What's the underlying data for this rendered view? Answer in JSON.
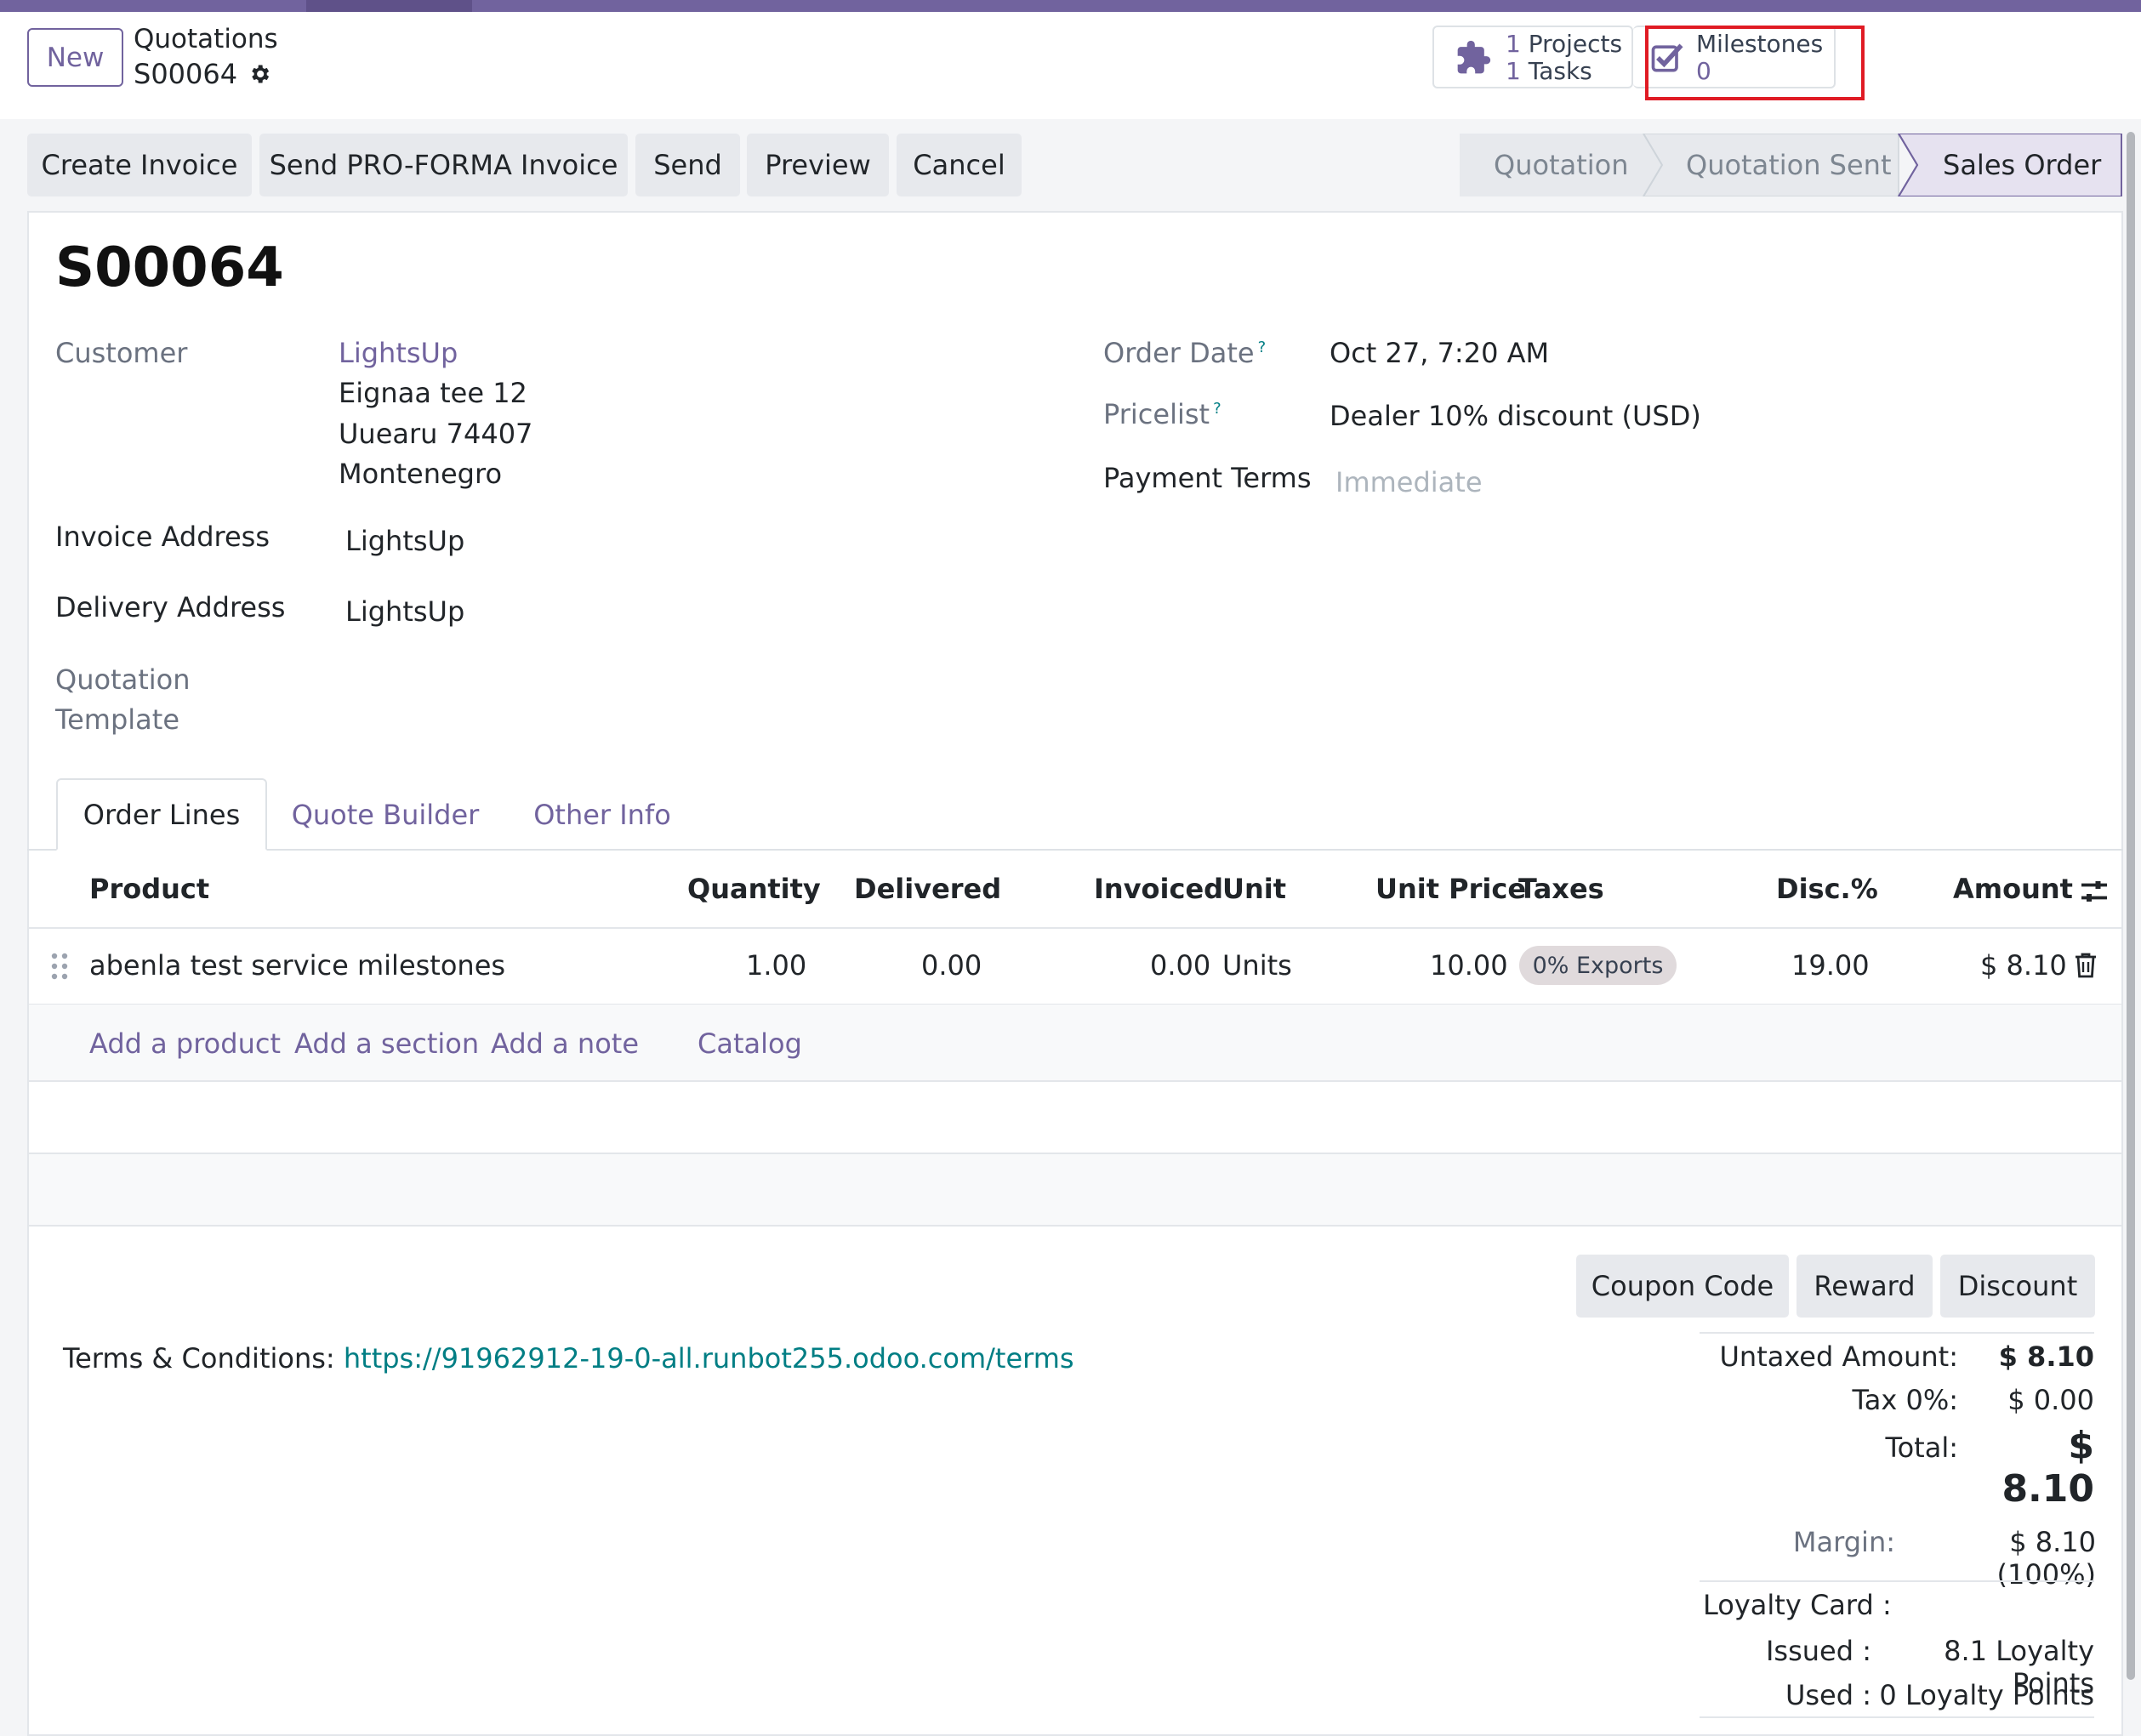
{
  "header": {
    "new_label": "New",
    "breadcrumb_parent": "Quotations",
    "breadcrumb_current": "S00064",
    "smart_buttons": {
      "projects_count": "1",
      "projects_label": "Projects",
      "tasks_count": "1",
      "tasks_label": "Tasks",
      "milestones_label": "Milestones",
      "milestones_count": "0"
    }
  },
  "actions": [
    "Create Invoice",
    "Send PRO-FORMA Invoice",
    "Send",
    "Preview",
    "Cancel"
  ],
  "statusbar": [
    "Quotation",
    "Quotation Sent",
    "Sales Order"
  ],
  "form": {
    "title": "S00064",
    "customer_label": "Customer",
    "customer_name": "LightsUp",
    "customer_address": [
      "Eignaa tee 12",
      "Uuearu 74407",
      "Montenegro"
    ],
    "invoice_address_label": "Invoice Address",
    "invoice_address": "LightsUp",
    "delivery_address_label": "Delivery Address",
    "delivery_address": "LightsUp",
    "quotation_template_label_1": "Quotation",
    "quotation_template_label_2": "Template",
    "order_date_label": "Order Date",
    "order_date": "Oct 27, 7:20 AM",
    "pricelist_label": "Pricelist",
    "pricelist": "Dealer 10% discount (USD)",
    "payment_terms_label": "Payment Terms",
    "payment_terms_placeholder": "Immediate",
    "help_mark": "?"
  },
  "tabs": [
    "Order Lines",
    "Quote Builder",
    "Other Info"
  ],
  "table": {
    "columns": [
      "Product",
      "Quantity",
      "Delivered",
      "Invoiced",
      "Unit",
      "Unit Price",
      "Taxes",
      "Disc.%",
      "Amount"
    ],
    "rows": [
      {
        "product": "abenla test service milestones",
        "quantity": "1.00",
        "delivered": "0.00",
        "invoiced": "0.00",
        "unit": "Units",
        "unit_price": "10.00",
        "taxes": "0% Exports",
        "discount": "19.00",
        "amount": "$ 8.10"
      }
    ],
    "add_links": [
      "Add a product",
      "Add a section",
      "Add a note",
      "Catalog"
    ]
  },
  "bottom": {
    "buttons": [
      "Coupon Code",
      "Reward",
      "Discount"
    ],
    "terms_label": "Terms & Conditions:",
    "terms_link": "https://91962912-19-0-all.runbot255.odoo.com/terms",
    "untaxed_label": "Untaxed Amount:",
    "untaxed_value": "$ 8.10",
    "tax_label": "Tax 0%:",
    "tax_value": "$ 0.00",
    "total_label": "Total:",
    "total_value": "$ 8.10",
    "margin_label": "Margin:",
    "margin_value": "$ 8.10 (100%)",
    "loyalty_label": "Loyalty Card :",
    "issued_label": "Issued :",
    "issued_value": "8.1 Loyalty Points",
    "used_label": "Used :",
    "used_value": "0 Loyalty Points"
  },
  "colors": {
    "brand": "#71639e",
    "link_teal": "#017e84",
    "highlight_red": "#e01b24"
  }
}
